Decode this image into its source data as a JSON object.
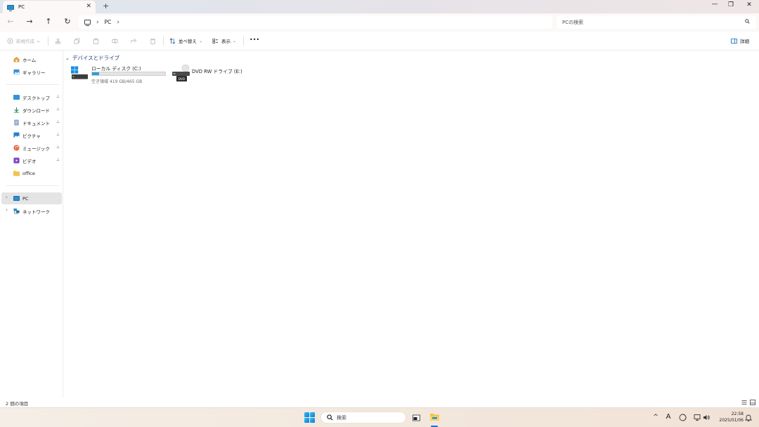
{
  "window": {
    "tab_title": "PC",
    "new_tab_label": "+",
    "close_tab_glyph": "✕",
    "controls": {
      "minimize": "—",
      "restore": "❐",
      "close": "✕"
    }
  },
  "nav": {
    "back_glyph": "←",
    "forward_glyph": "→",
    "up_glyph": "↑",
    "refresh_glyph": "↻"
  },
  "address": {
    "crumbs": [
      "PC"
    ],
    "separator": "›"
  },
  "search": {
    "placeholder": "PCの検索"
  },
  "toolbar": {
    "new_label": "新規作成",
    "sort_label": "並べ替え",
    "view_label": "表示",
    "more_label": "•••",
    "details_label": "詳細"
  },
  "sidebar": {
    "quick": [
      {
        "label": "ホーム",
        "icon": "home-icon"
      },
      {
        "label": "ギャラリー",
        "icon": "gallery-icon"
      }
    ],
    "pinned": [
      {
        "label": "デスクトップ",
        "icon": "desktop-icon",
        "pinned": true
      },
      {
        "label": "ダウンロード",
        "icon": "download-icon",
        "pinned": true
      },
      {
        "label": "ドキュメント",
        "icon": "documents-icon",
        "pinned": true
      },
      {
        "label": "ピクチャ",
        "icon": "pictures-icon",
        "pinned": true
      },
      {
        "label": "ミュージック",
        "icon": "music-icon",
        "pinned": true
      },
      {
        "label": "ビデオ",
        "icon": "videos-icon",
        "pinned": true
      },
      {
        "label": "office",
        "icon": "folder-icon",
        "pinned": false
      }
    ],
    "tree": [
      {
        "label": "PC",
        "icon": "pc-icon",
        "selected": true
      },
      {
        "label": "ネットワーク",
        "icon": "network-icon",
        "selected": false
      }
    ],
    "pin_glyph": "📌",
    "expand_glyph": "›"
  },
  "content": {
    "group_header": "デバイスとドライブ",
    "drives": [
      {
        "name": "ローカル ディスク (C:)",
        "free_space": "空き領域 419 GB/465 GB",
        "used_fraction": 0.099,
        "icon": "local-disk-icon"
      },
      {
        "name": "DVD RW ドライブ (E:)",
        "icon": "dvd-drive-icon",
        "badge": "DVD"
      }
    ]
  },
  "status": {
    "item_count": "2 個の項目"
  },
  "taskbar": {
    "search_placeholder": "検索",
    "tray": {
      "chevron": "^",
      "ime": "A"
    },
    "clock": {
      "time": "22:58",
      "date": "2025/01/06"
    }
  },
  "colors": {
    "accent": "#26a0da",
    "selected_bg": "#e4e4e4",
    "group_header": "#1f3b6e"
  }
}
